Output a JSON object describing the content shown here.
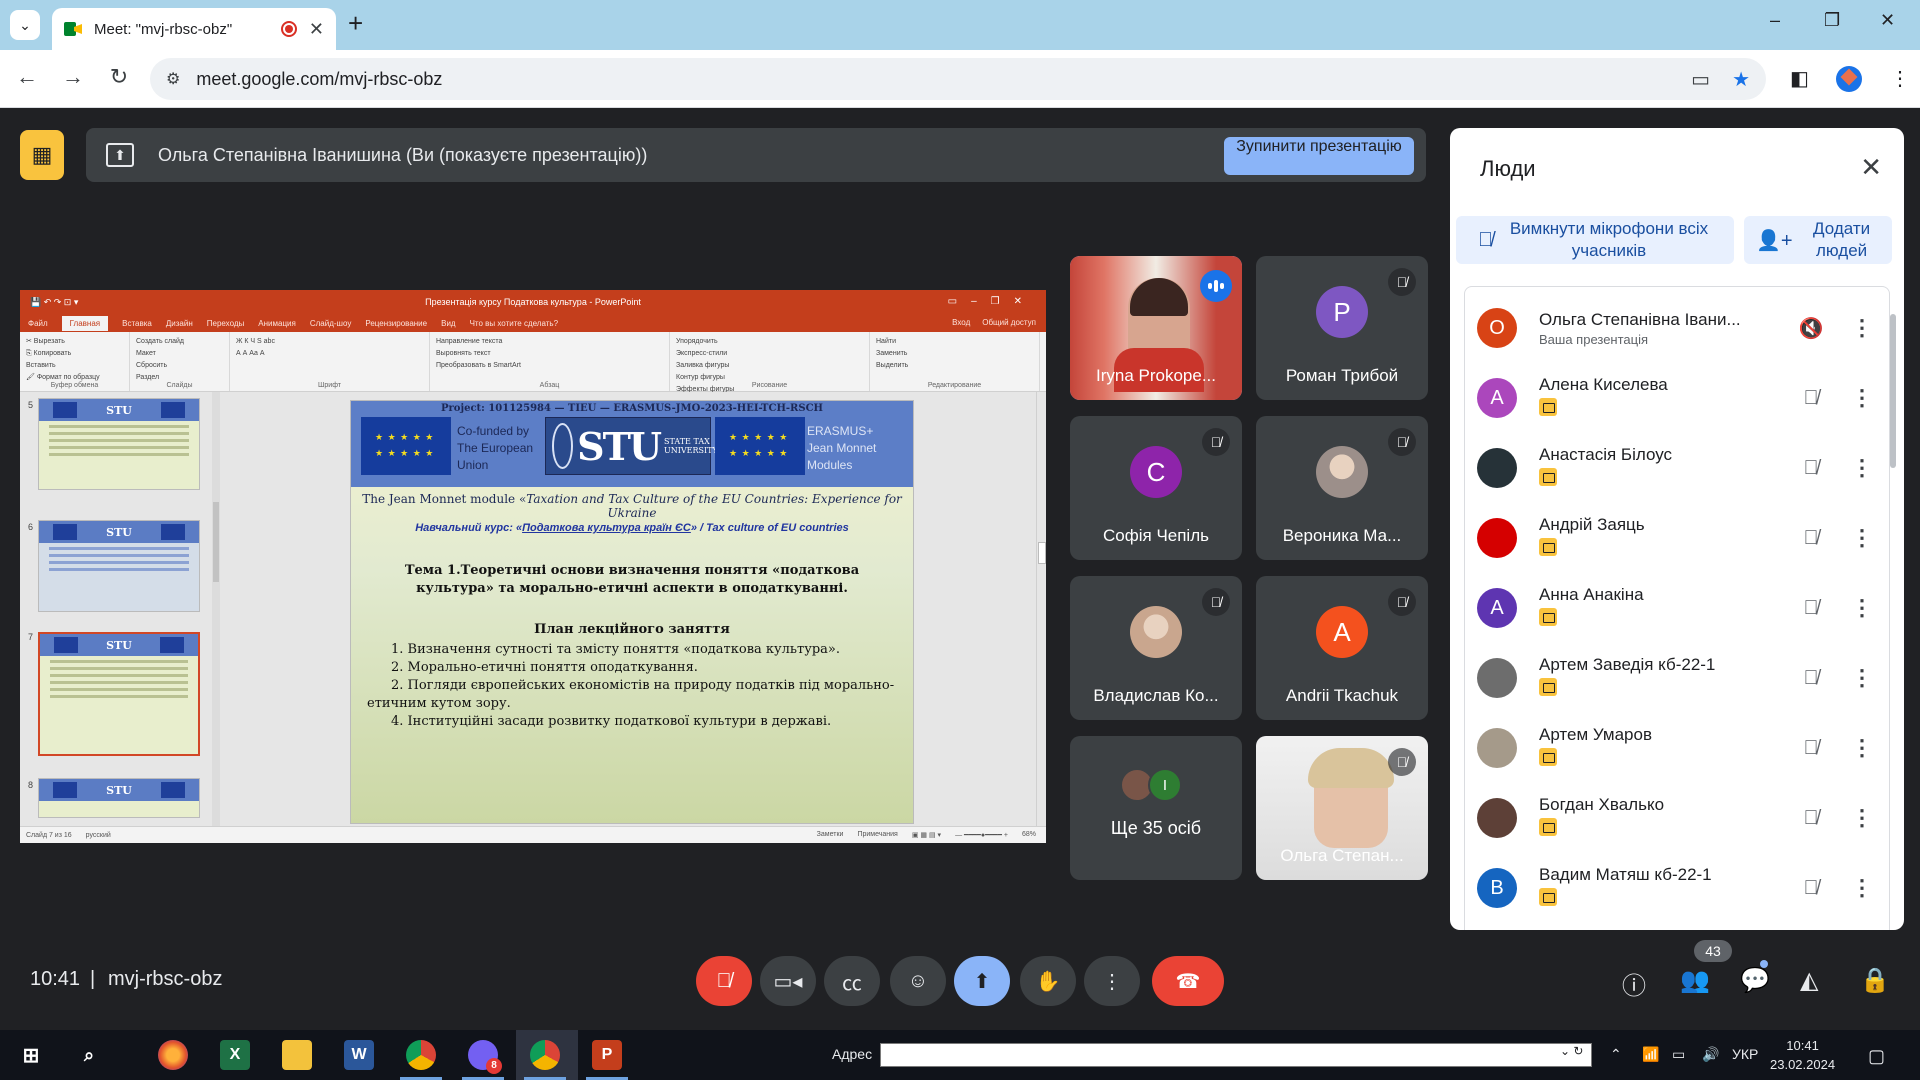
{
  "browser": {
    "tab_title": "Meet: \"mvj-rbsc-obz\"",
    "url": "meet.google.com/mvj-rbsc-obz",
    "window_controls": [
      "–",
      "❐",
      "✕"
    ]
  },
  "presentation_banner": {
    "text": "Ольга Степанівна Іванишина (Ви (показуєте презентацію))",
    "stop_button": "Зупинити презентацію"
  },
  "powerpoint": {
    "window_title": "Презентація курсу Податкова культура - PowerPoint",
    "tabs": [
      "Файл",
      "Главная",
      "Вставка",
      "Дизайн",
      "Переходы",
      "Анимация",
      "Слайд-шоу",
      "Рецензирование",
      "Вид",
      "Что вы хотите сделать?"
    ],
    "right_tabs": [
      "Вход",
      "Общий доступ"
    ],
    "ribbon_groups": [
      {
        "label": "Буфер обмена",
        "lines": [
          "✂ Вырезать",
          "⎘ Копировать",
          "Вставить",
          "🖌 Формат по образцу"
        ]
      },
      {
        "label": "Слайды",
        "lines": [
          "Создать слайд",
          "Макет",
          "Сбросить",
          "Раздел"
        ]
      },
      {
        "label": "Шрифт",
        "lines": [
          "Ж К Ч S abc",
          "А А Аа А"
        ]
      },
      {
        "label": "Абзац",
        "lines": [
          "Направление текста",
          "Выровнять текст",
          "Преобразовать в SmartArt"
        ]
      },
      {
        "label": "Рисование",
        "lines": [
          "Упорядочить",
          "Экспресс-стили",
          "Заливка фигуры",
          "Контур фигуры",
          "Эффекты фигуры"
        ]
      },
      {
        "label": "Редактирование",
        "lines": [
          "Найти",
          "Заменить",
          "Выделить"
        ]
      }
    ],
    "thumbnail_numbers": [
      "5",
      "6",
      "7",
      "8"
    ],
    "status_left": [
      "Слайд 7 из 16",
      "русский"
    ],
    "status_right": [
      "Заметки",
      "Примечания",
      "68%"
    ],
    "slide": {
      "project": "Project: 101125984 — TIEU — ERASMUS-JMO-2023-HEI-TCH-RSCH",
      "cofunded": "Co-funded by The European Union",
      "stu_letters": "STU",
      "stu_words": "STATE TAX UNIVERSITY",
      "jm_text": "ERASMUS+ Jean Monnet Modules",
      "module_prefix": "The Jean Monnet module «",
      "module_title": "Taxation and Tax Culture of the EU Countries: Experience for Ukraine",
      "course_prefix": "Навчальний курс: «",
      "course_title": "Податкова культура країн ЄС",
      "course_suffix": "» / Tax culture of EU countries",
      "topic": "Тема 1.Теоретичні основи визначення поняття «податкова культура» та морально-етичні аспекти в оподаткуванні.",
      "plan_title": "План лекційного заняття",
      "plan": [
        "1. Визначення сутності та змісту поняття «податкова культура».",
        "2. Морально-етичні поняття оподаткування.",
        "2. Погляди європейських економістів на природу податків під морально-етичним кутом зору.",
        "4. Інституційні засади розвитку податкової культури в державі."
      ]
    }
  },
  "tiles": [
    {
      "name": "Iryna Prokope...",
      "type": "video1",
      "speaking": true
    },
    {
      "name": "Роман Трибой",
      "type": "letter",
      "letter": "P",
      "color": "#7e57c2"
    },
    {
      "name": "Софія Чепіль",
      "type": "letter",
      "letter": "C",
      "color": "#8e24aa"
    },
    {
      "name": "Вероника Ма...",
      "type": "photo",
      "color": "#9c8f8a"
    },
    {
      "name": "Владислав Ко...",
      "type": "photo",
      "color": "#c9a68e"
    },
    {
      "name": "Andrii Tkachuk",
      "type": "letter",
      "letter": "A",
      "color": "#f4511e"
    },
    {
      "name": "Ще 35 осіб",
      "type": "more",
      "letter": "I"
    },
    {
      "name": "Ольга Степан...",
      "type": "video2"
    }
  ],
  "people_panel": {
    "title": "Люди",
    "mute_all": "Вимкнути мікрофони всіх учасників",
    "add_people": "Додати людей",
    "people": [
      {
        "name": "Ольга Степанівна Івани...",
        "sub": "Ваша презентація",
        "initial": "О",
        "color": "#d84315",
        "badge": false
      },
      {
        "name": "Алена Киселева",
        "sub": "",
        "initial": "А",
        "color": "#ab47bc",
        "badge": true
      },
      {
        "name": "Анастасія Білоус",
        "sub": "",
        "initial": "",
        "color": "#263238",
        "badge": true
      },
      {
        "name": "Андрій Заяць",
        "sub": "",
        "initial": "",
        "color": "#d50000",
        "badge": true
      },
      {
        "name": "Анна Анакіна",
        "sub": "",
        "initial": "А",
        "color": "#5e35b1",
        "badge": true
      },
      {
        "name": "Артем Заведія кб-22-1",
        "sub": "",
        "initial": "",
        "color": "#6d6d6d",
        "badge": true
      },
      {
        "name": "Артем Умаров",
        "sub": "",
        "initial": "",
        "color": "#a59a8a",
        "badge": true
      },
      {
        "name": "Богдан Хвалько",
        "sub": "",
        "initial": "",
        "color": "#5d4037",
        "badge": true
      },
      {
        "name": "Вадим Матяш кб-22-1",
        "sub": "",
        "initial": "В",
        "color": "#1565c0",
        "badge": true
      }
    ]
  },
  "bottom_bar": {
    "time": "10:41",
    "separator": "|",
    "meeting_code": "mvj-rbsc-obz",
    "people_count": "43"
  },
  "taskbar": {
    "address_label": "Адрес",
    "language": "УКР",
    "time": "10:41",
    "date": "23.02.2024",
    "apps": [
      "Firefox",
      "Excel",
      "Explorer",
      "Word",
      "Chrome",
      "Viber",
      "Chrome",
      "PowerPoint"
    ],
    "viber_badge": "8"
  },
  "colors": {
    "meet_bg": "#202124",
    "tile_bg": "#3c4043",
    "accent": "#8ab4f8",
    "end_call": "#ea4335",
    "presenting": "#f9c33e"
  }
}
